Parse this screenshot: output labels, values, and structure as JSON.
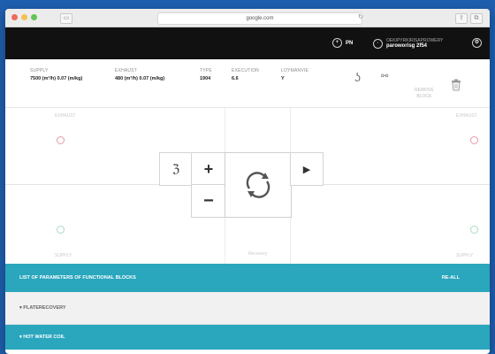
{
  "browser": {
    "url": "google.com"
  },
  "topbar": {
    "language": "PN",
    "user_name": "paroworisg 2f54",
    "user_sub": "OEKIPYRKIRISAPROWERY"
  },
  "info": {
    "columns": [
      {
        "label": "SUPPLY",
        "value": "7500 (m³/h)   0.07 (m/kg)"
      },
      {
        "label": "EXHAUST",
        "value": "480 (m³/h)   0.07 (m/kg)"
      },
      {
        "label": "TYPE",
        "value": "1904"
      },
      {
        "label": "EXECUTION",
        "value": "6.6"
      },
      {
        "label": "LOYMANVIE",
        "value": "Y"
      }
    ],
    "remove_block": "REMOVE\nBLOCK"
  },
  "workspace": {
    "corner_tl": "EXHAUST",
    "corner_tr": "EXHAUST",
    "corner_bl": "SUPPLY",
    "corner_br": "SUPPLY",
    "bottom_center": "Recovery"
  },
  "list_bar": {
    "title": "LIST OF PARAMETERS OF FUNCTIONAL BLOCKS",
    "action": "RE-ALL"
  },
  "section_plate": {
    "title": "▾  PLATERECOVERY"
  },
  "section_coil": {
    "title": "▾  HOT WATER COIL"
  },
  "colors": {
    "accent": "#2aa6bd",
    "topbar": "#111111",
    "background": "#1f5fb0"
  }
}
